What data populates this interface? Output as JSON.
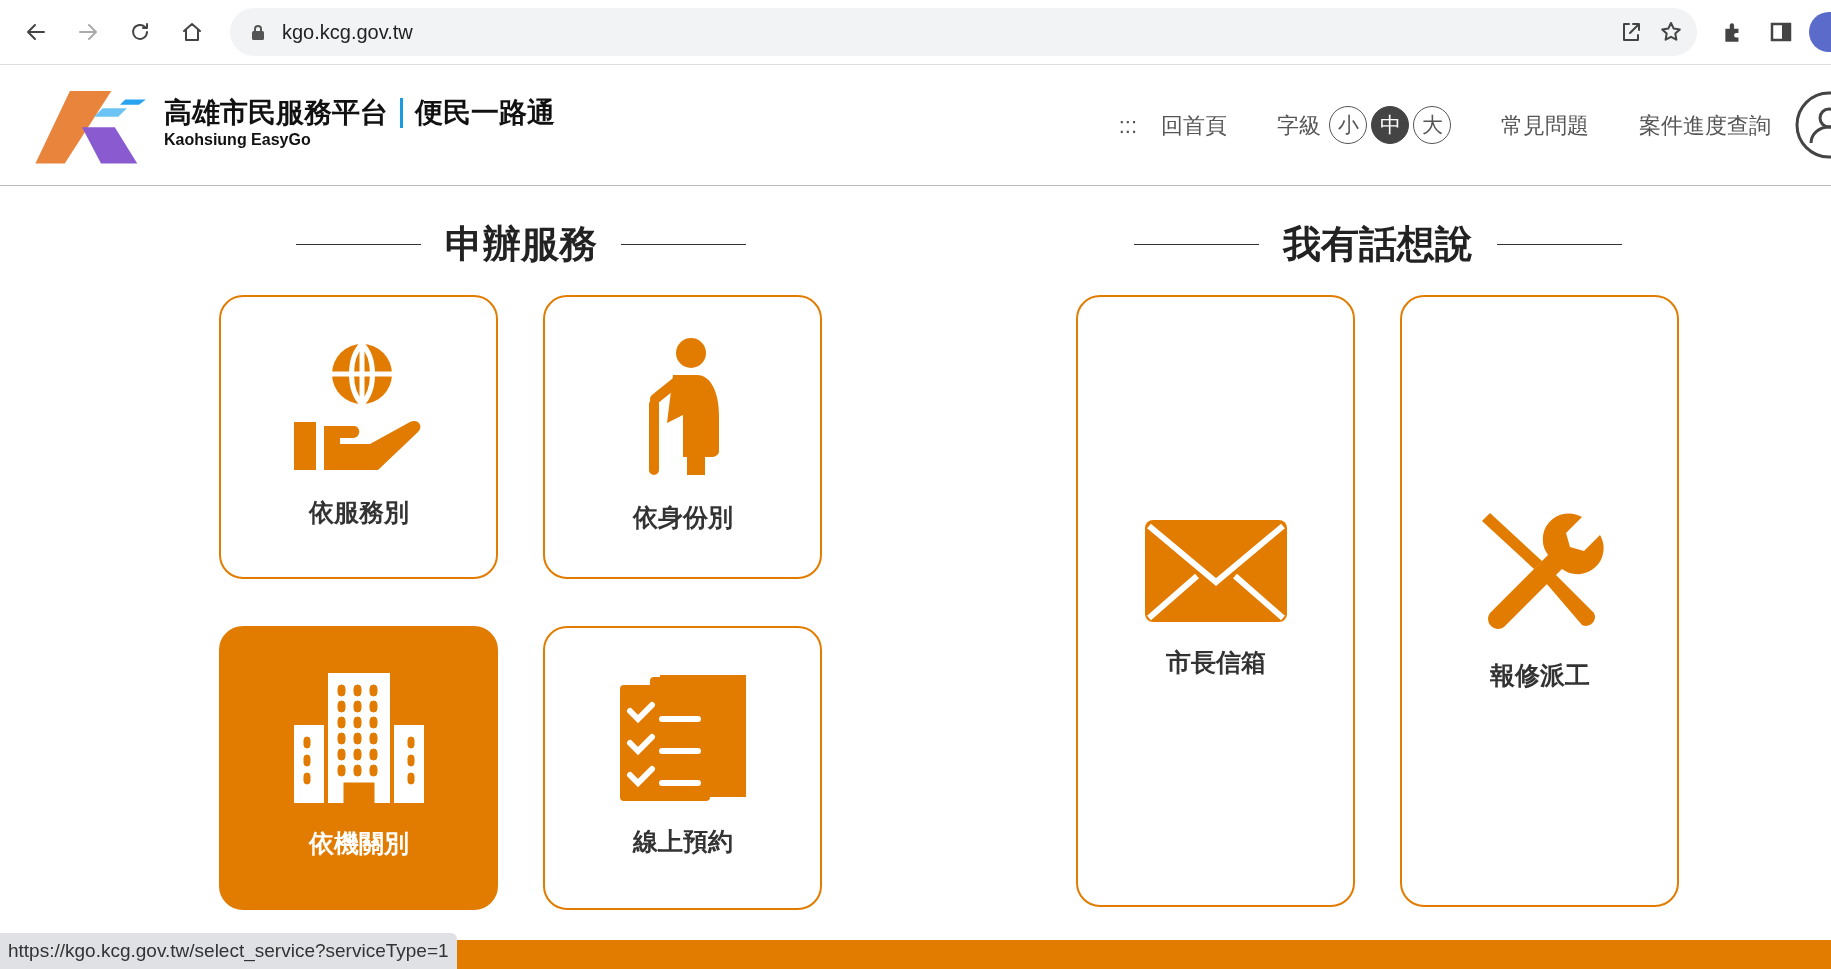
{
  "browser": {
    "url": "kgo.kcg.gov.tw",
    "forward_disabled": true
  },
  "header": {
    "logo_title": "高雄市民服務平台",
    "logo_tagline": "便民一路通",
    "logo_en": "Kaohsiung EasyGo",
    "accesskey": ":::",
    "home": "回首頁",
    "font_size": {
      "label": "字級",
      "options": [
        {
          "label": "小",
          "selected": false
        },
        {
          "label": "中",
          "selected": true
        },
        {
          "label": "大",
          "selected": false
        }
      ]
    },
    "links": [
      "常見問題",
      "案件進度查詢"
    ]
  },
  "sections": [
    {
      "title": "申辦服務",
      "cards": [
        {
          "label": "依服務別",
          "selected": false
        },
        {
          "label": "依身份別",
          "selected": false
        },
        {
          "label": "依機關別",
          "selected": true
        },
        {
          "label": "線上預約",
          "selected": false
        }
      ]
    },
    {
      "title": "我有話想說",
      "cards": [
        {
          "label": "市長信箱",
          "selected": false
        },
        {
          "label": "報修派工",
          "selected": false
        }
      ]
    }
  ],
  "status_url": "https://kgo.kcg.gov.tw/select_service?serviceType=1"
}
